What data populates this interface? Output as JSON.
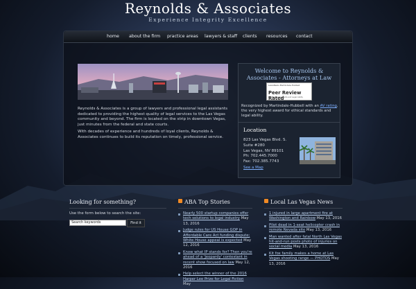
{
  "site": {
    "title": "Reynolds & Associates",
    "tagline": "Experience Integrity Excellence"
  },
  "nav": {
    "items": [
      "home",
      "about the firm",
      "practice areas",
      "lawyers & staff",
      "clients",
      "resources",
      "contact"
    ]
  },
  "intro": {
    "paragraph1": "Reynolds & Associates is a group of lawyers and professional legal assistants dedicated to providing the highest quality of legal services to the Las Vegas community and beyond. The firm is located on the strip in downtown Vegas, just minutes from the federal and state courts.",
    "paragraph2": "With decades of experience and hundreds of loyal clients, Reynolds & Associates continues to build its reputation on timely, professional service."
  },
  "welcome": {
    "title": "Welcome to Reynolds & Associates - Attorneys at Law",
    "badge_top": "LexisNexis Martindale-Hubbell",
    "badge_main": "Peer Review Rated",
    "badge_bottom": "For Ethical Standards and Legal Ability",
    "text_before": "Recognized by Martindale-Hubbell with an ",
    "link": "AV rating",
    "text_after": ", the very highest award for ethical standards and legal ability."
  },
  "location": {
    "title": "Location",
    "address1": "823 Las Vegas Blvd. S.",
    "address2": "Suite #280",
    "address3": "Las Vegas, NV 89101",
    "phone": "Ph: 702.445.7000",
    "fax": "Fax: 702.385.7743",
    "map_link": "See a Map"
  },
  "search": {
    "title": "Looking for something?",
    "description": "Use the form below to search the site:",
    "placeholder": "Search keywords",
    "button": "Find it"
  },
  "aba": {
    "title": "ABA Top Stories",
    "items": [
      {
        "link": "Nearly 500 startup companies offer tech solutions to legal industry",
        "date": " May 13, 2016"
      },
      {
        "link": "Judge rules for US House GOP in Affordable Care Act funding dispute; White House appeal is expected",
        "date": " May 12, 2016"
      },
      {
        "link": "Know what IP stands for? Then you're ahead of a 'Jeopardy' contestant in recent show focused on law",
        "date": " May 12, 2016"
      },
      {
        "link": "Help select the winner of the 2016 Harper Lee Prize for Legal Fiction",
        "date": " May"
      }
    ]
  },
  "lvnews": {
    "title": "Local Las Vegas News",
    "items": [
      {
        "link": "1 injured in large apartment fire at Washington and Rainbow",
        "date": " May 13, 2016"
      },
      {
        "link": "Pilot dead in 1-seat helicopter crash in remote Nevada site",
        "date": " May 13, 2016"
      },
      {
        "link": "Man wanted after fatal North Las Vegas hit-and-run posts photo of injuries on social media",
        "date": " May 13, 2016"
      },
      {
        "link": "Kit fox family makes a home at Las Vegas shooting range — PHOTOS",
        "date": " May 13, 2016"
      }
    ]
  }
}
